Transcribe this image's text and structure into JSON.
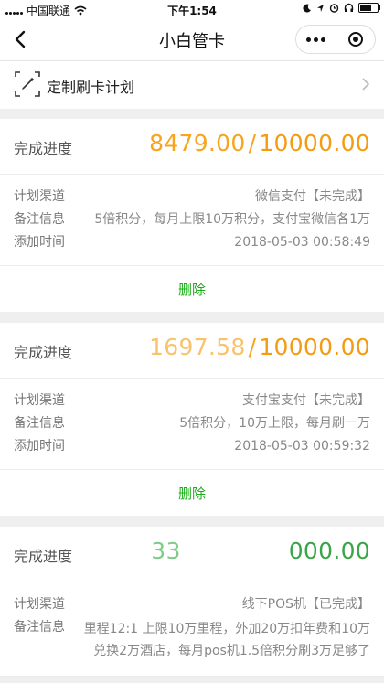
{
  "status_bar": {
    "carrier": "中国联通",
    "time": "下午1:54"
  },
  "nav": {
    "title": "小白管卡"
  },
  "custom_plan": {
    "label": "定制刷卡计划"
  },
  "labels": {
    "progress": "完成进度",
    "channel": "计划渠道",
    "note": "备注信息",
    "added": "添加时间",
    "delete": "删除"
  },
  "plans": [
    {
      "done": "8479.00",
      "slash": "/",
      "total": "10000.00",
      "channel": "微信支付【未完成】",
      "note": "5倍积分，每月上限10万积分，支付宝微信各1万",
      "added": "2018-05-03 00:58:49"
    },
    {
      "done": "1697.58",
      "slash": "/",
      "total": "10000.00",
      "channel": "支付宝支付【未完成】",
      "note": "5倍积分，10万上限，每月刷一万",
      "added": "2018-05-03 00:59:32"
    },
    {
      "done": "33",
      "slash": "",
      "total": "000.00",
      "channel": "线下POS机【已完成】",
      "note": "里程12:1 上限10万里程，外加20万扣年费和10万兑换2万酒店，每月pos机1.5倍积分刷3万足够了"
    }
  ],
  "colors": {
    "accent_orange": "#f7a51e",
    "accent_green": "#3aa548",
    "delete_green": "#1aad19"
  }
}
